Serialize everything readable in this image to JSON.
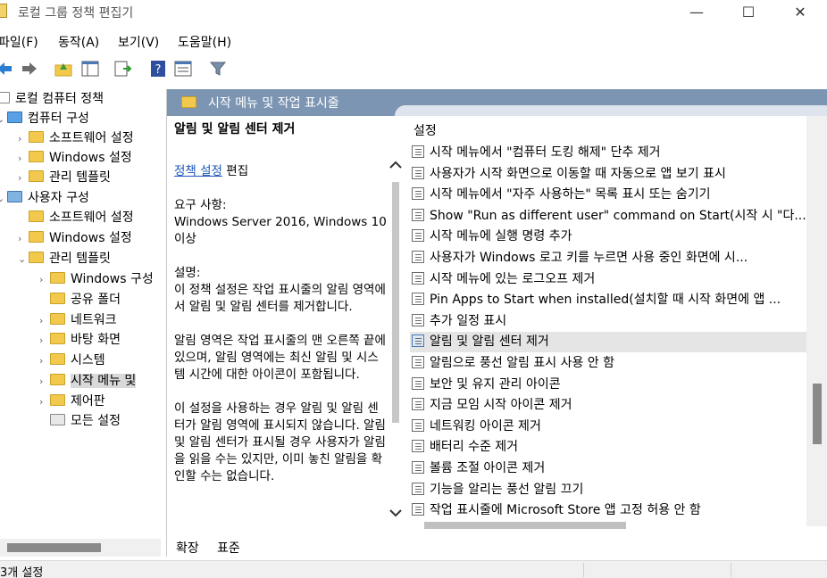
{
  "window": {
    "title": "로컬 그룹 정책 편집기",
    "min": "—",
    "max": "☐",
    "close": "✕"
  },
  "menu": {
    "file": "파일(F)",
    "action": "동작(A)",
    "view": "보기(V)",
    "help": "도움말(H)"
  },
  "tree": {
    "root": "로컬 컴퓨터 정책",
    "computer_config": "컴퓨터 구성",
    "cc_software": "소프트웨어 설정",
    "cc_windows": "Windows 설정",
    "cc_admin": "관리 템플릿",
    "user_config": "사용자 구성",
    "uc_software": "소프트웨어 설정",
    "uc_windows": "Windows 설정",
    "uc_admin": "관리 템플릿",
    "ua_windows_components": "Windows 구성",
    "ua_shared_folders": "공유 폴더",
    "ua_network": "네트워크",
    "ua_desktop": "바탕 화면",
    "ua_system": "시스템",
    "ua_start_menu": "시작 메뉴 및",
    "ua_control_panel": "제어판",
    "ua_all_settings": "모든 설정"
  },
  "header": {
    "title": "시작 메뉴 및 작업 표시줄"
  },
  "description": {
    "policy_title": "알림 및 알림 센터 제거",
    "edit_link": "정책 설정",
    "edit_suffix": " 편집",
    "requirements_label": "요구 사항:",
    "requirements_value": "Windows Server 2016, Windows 10 이상",
    "desc_label": "설명:",
    "desc_p1": "이 정책 설정은 작업 표시줄의 알림 영역에서 알림 및 알림 센터를 제거합니다.",
    "desc_p2": "알림 영역은 작업 표시줄의 맨 오른쪽 끝에 있으며, 알림 영역에는 최신 알림 및 시스템 시간에 대한 아이콘이 포함됩니다.",
    "desc_p3": "이 설정을 사용하는 경우 알림 및 알림 센터가 알림 영역에 표시되지 않습니다. 알림 및 알림 센터가 표시될 경우 사용자가 알림을 읽을 수는 있지만, 이미 놓친 알림을 확인할 수는 없습니다."
  },
  "settings": {
    "column_header": "설정",
    "rows": [
      "시작 메뉴에서 \"컴퓨터 도킹 해제\" 단추 제거",
      "사용자가 시작 화면으로 이동할 때 자동으로 앱 보기 표시",
      "시작 메뉴에서 \"자주 사용하는\" 목록 표시 또는 숨기기",
      "Show \"Run as different user\" command on Start(시작 시 \"다...",
      "시작 메뉴에 실행 명령 추가",
      "사용자가 Windows 로고 키를 누르면 사용 중인 화면에 시...",
      "시작 메뉴에 있는 로그오프 제거",
      "Pin Apps to Start when installed(설치할 때 시작 화면에 앱 ...",
      "추가 일정 표시",
      "알림 및 알림 센터 제거",
      "알림으로 풍선 알림 표시 사용 안 함",
      "보안 및 유지 관리 아이콘",
      "지금 모임 시작 아이콘 제거",
      "네트워킹 아이콘 제거",
      "배터리 수준 제거",
      "볼륨 조절 아이콘 제거",
      "기능을 알리는 풍선 알림 끄기",
      "작업 표시줄에 Microsoft Store 앱 고정 허용 안 함"
    ],
    "selected_index": 9
  },
  "bottom_tabs": {
    "extended": "확장",
    "standard": "표준"
  },
  "status": {
    "text": "3개 설정"
  }
}
